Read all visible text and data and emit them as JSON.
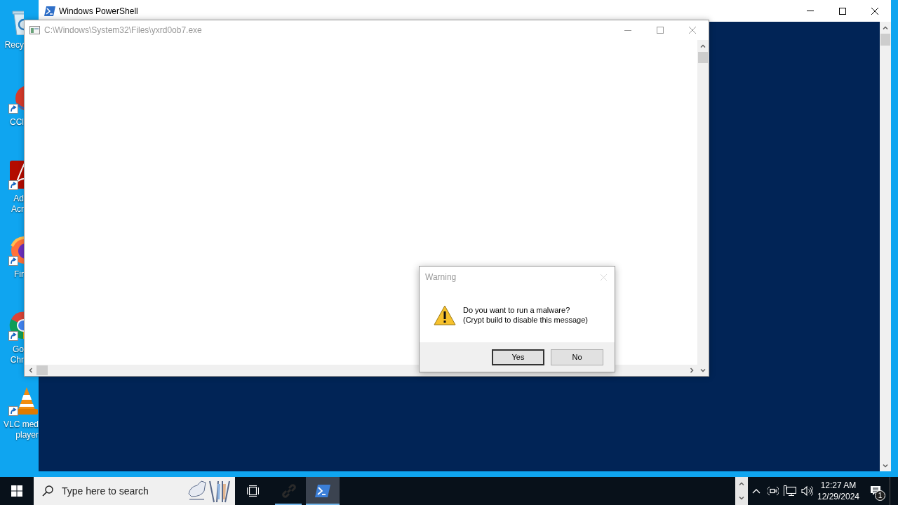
{
  "desktop_icons": [
    {
      "kind": "recycle-bin",
      "shortcut": false,
      "label_lines": [
        "Recy"
      ]
    },
    {
      "kind": "ccleaner",
      "shortcut": true,
      "label_lines": [
        "CCl"
      ]
    },
    {
      "kind": "acrobat",
      "shortcut": true,
      "label_lines": [
        "Ad",
        "Acr"
      ]
    },
    {
      "kind": "firefox",
      "shortcut": true,
      "label_lines": [
        "Fir"
      ]
    },
    {
      "kind": "chrome",
      "shortcut": true,
      "label_lines": [
        "Go",
        "Chr"
      ]
    },
    {
      "kind": "vlc",
      "shortcut": true,
      "label_lines": [
        "VLC med",
        "player"
      ]
    }
  ],
  "powershell_window": {
    "title": "Windows PowerShell",
    "active": true
  },
  "exe_window": {
    "title": "C:\\Windows\\System32\\Files\\yxrd0ob7.exe",
    "active": false
  },
  "dialog": {
    "title": "Warning",
    "close_disabled": true,
    "message_lines": [
      "Do you want to run a malware?",
      "(Crypt build to disable this message)"
    ],
    "buttons": [
      {
        "label": "Yes",
        "default": true
      },
      {
        "label": "No",
        "default": false
      }
    ]
  },
  "taskbar": {
    "search": {
      "placeholder": "Type here to search"
    },
    "apps": [
      {
        "kind": "link",
        "running": true,
        "selected": false
      },
      {
        "kind": "powershell",
        "running": true,
        "selected": true
      }
    ],
    "clock": {
      "time": "12:27 AM",
      "date": "12/29/2024"
    },
    "notifications": {
      "count": "1"
    }
  }
}
